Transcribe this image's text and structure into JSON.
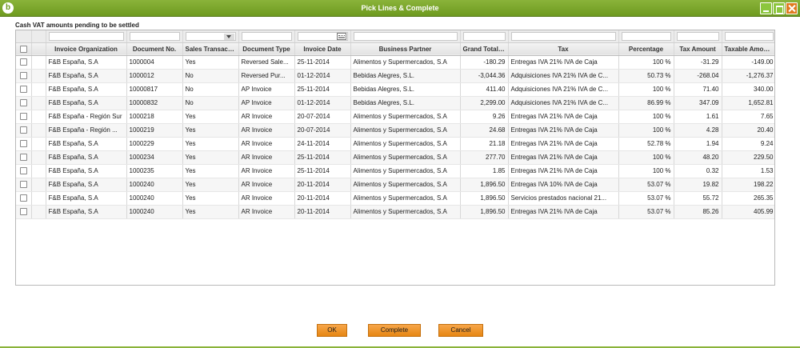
{
  "window": {
    "title": "Pick Lines & Complete",
    "logo_glyph": "b"
  },
  "section_label": "Cash VAT amounts pending to be settled",
  "columns": [
    "Invoice Organization",
    "Document No.",
    "Sales Transaction",
    "Document Type",
    "Invoice Date",
    "Business Partner",
    "Grand Total A...",
    "Tax",
    "Percentage",
    "Tax Amount",
    "Taxable Amount"
  ],
  "rows": [
    [
      "F&B España, S.A",
      "1000004",
      "Yes",
      "Reversed Sale...",
      "25-11-2014",
      "Alimentos y Supermercados, S.A",
      "-180.29",
      "Entregas IVA 21% IVA de Caja",
      "100 %",
      "-31.29",
      "-149.00"
    ],
    [
      "F&B España, S.A",
      "1000012",
      "No",
      "Reversed Pur...",
      "01-12-2014",
      "Bebidas Alegres, S.L.",
      "-3,044.36",
      "Adquisiciones IVA 21% IVA de C...",
      "50.73 %",
      "-268.04",
      "-1,276.37"
    ],
    [
      "F&B España, S.A",
      "10000817",
      "No",
      "AP Invoice",
      "25-11-2014",
      "Bebidas Alegres, S.L.",
      "411.40",
      "Adquisiciones IVA 21% IVA de C...",
      "100 %",
      "71.40",
      "340.00"
    ],
    [
      "F&B España, S.A",
      "10000832",
      "No",
      "AP Invoice",
      "01-12-2014",
      "Bebidas Alegres, S.L.",
      "2,299.00",
      "Adquisiciones IVA 21% IVA de C...",
      "86.99 %",
      "347.09",
      "1,652.81"
    ],
    [
      "F&B España - Región Sur",
      "1000218",
      "Yes",
      "AR Invoice",
      "20-07-2014",
      "Alimentos y Supermercados, S.A",
      "9.26",
      "Entregas IVA 21% IVA de Caja",
      "100 %",
      "1.61",
      "7.65"
    ],
    [
      "F&B España - Región ...",
      "1000219",
      "Yes",
      "AR Invoice",
      "20-07-2014",
      "Alimentos y Supermercados, S.A",
      "24.68",
      "Entregas IVA 21% IVA de Caja",
      "100 %",
      "4.28",
      "20.40"
    ],
    [
      "F&B España, S.A",
      "1000229",
      "Yes",
      "AR Invoice",
      "24-11-2014",
      "Alimentos y Supermercados, S.A",
      "21.18",
      "Entregas IVA 21% IVA de Caja",
      "52.78 %",
      "1.94",
      "9.24"
    ],
    [
      "F&B España, S.A",
      "1000234",
      "Yes",
      "AR Invoice",
      "25-11-2014",
      "Alimentos y Supermercados, S.A",
      "277.70",
      "Entregas IVA 21% IVA de Caja",
      "100 %",
      "48.20",
      "229.50"
    ],
    [
      "F&B España, S.A",
      "1000235",
      "Yes",
      "AR Invoice",
      "25-11-2014",
      "Alimentos y Supermercados, S.A",
      "1.85",
      "Entregas IVA 21% IVA de Caja",
      "100 %",
      "0.32",
      "1.53"
    ],
    [
      "F&B España, S.A",
      "1000240",
      "Yes",
      "AR Invoice",
      "20-11-2014",
      "Alimentos y Supermercados, S.A",
      "1,896.50",
      "Entregas IVA 10% IVA de Caja",
      "53.07 %",
      "19.82",
      "198.22"
    ],
    [
      "F&B España, S.A",
      "1000240",
      "Yes",
      "AR Invoice",
      "20-11-2014",
      "Alimentos y Supermercados, S.A",
      "1,896.50",
      "Servicios prestados nacional 21...",
      "53.07 %",
      "55.72",
      "265.35"
    ],
    [
      "F&B España, S.A",
      "1000240",
      "Yes",
      "AR Invoice",
      "20-11-2014",
      "Alimentos y Supermercados, S.A",
      "1,896.50",
      "Entregas IVA 21% IVA de Caja",
      "53.07 %",
      "85.26",
      "405.99"
    ]
  ],
  "buttons": {
    "ok": "OK",
    "complete": "Complete",
    "cancel": "Cancel"
  },
  "colors": {
    "titlebar": "#7aa52a",
    "button": "#f29a30",
    "close": "#e07b1f"
  },
  "icons": {
    "sales_filter": "dropdown-arrow-icon",
    "date_filter": "calendar-icon"
  }
}
